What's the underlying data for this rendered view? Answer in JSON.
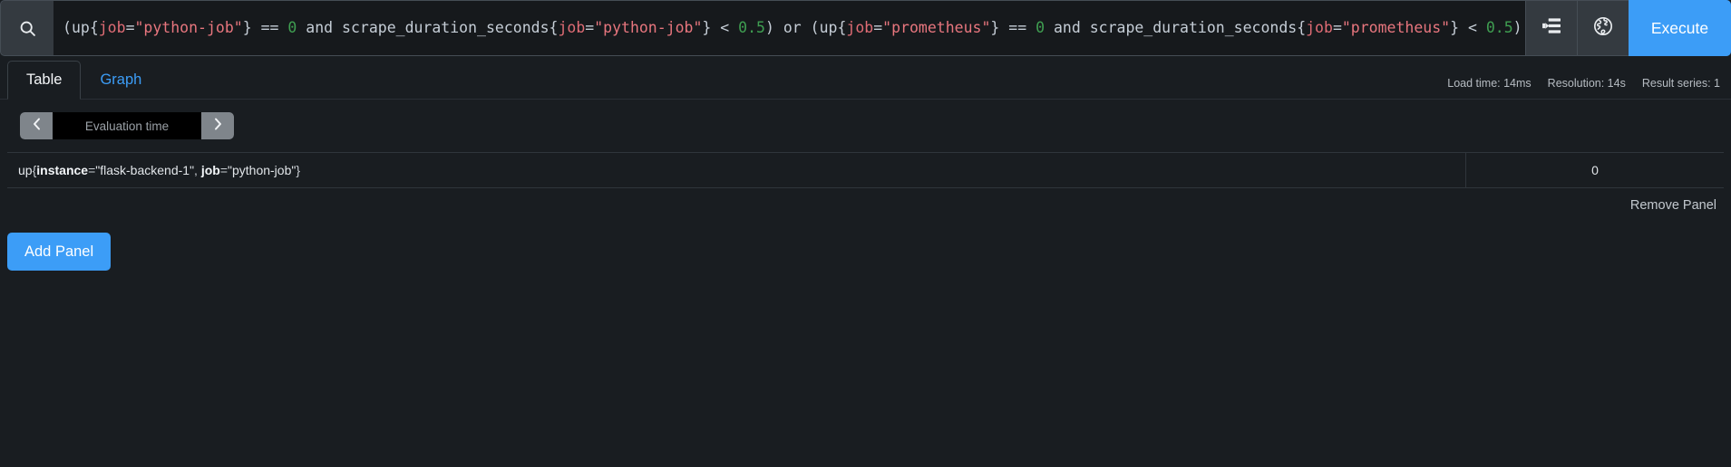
{
  "query_bar": {
    "search_icon": "search-icon",
    "metrics_explorer_icon": "metrics-explorer-icon",
    "globe_icon": "globe-icon",
    "execute_label": "Execute",
    "expression_plain": "(up{job=\"python-job\"} == 0 and scrape_duration_seconds{job=\"python-job\"} < 0.5) or (up{job=\"prometheus\"} == 0 and scrape_duration_seconds{job=\"prometheus\"} < 0.5)",
    "expression_tokens": [
      {
        "t": "(",
        "c": "punct"
      },
      {
        "t": "up",
        "c": "ident"
      },
      {
        "t": "{",
        "c": "punct"
      },
      {
        "t": "job",
        "c": "label"
      },
      {
        "t": "=",
        "c": "op"
      },
      {
        "t": "\"python-job\"",
        "c": "string"
      },
      {
        "t": "}",
        "c": "punct"
      },
      {
        "t": " ",
        "c": "punct"
      },
      {
        "t": "==",
        "c": "op"
      },
      {
        "t": " ",
        "c": "punct"
      },
      {
        "t": "0",
        "c": "number"
      },
      {
        "t": " ",
        "c": "punct"
      },
      {
        "t": "and",
        "c": "kw"
      },
      {
        "t": " ",
        "c": "punct"
      },
      {
        "t": "scrape_duration_seconds",
        "c": "ident"
      },
      {
        "t": "{",
        "c": "punct"
      },
      {
        "t": "job",
        "c": "label"
      },
      {
        "t": "=",
        "c": "op"
      },
      {
        "t": "\"python-job\"",
        "c": "string"
      },
      {
        "t": "}",
        "c": "punct"
      },
      {
        "t": " ",
        "c": "punct"
      },
      {
        "t": "<",
        "c": "op"
      },
      {
        "t": " ",
        "c": "punct"
      },
      {
        "t": "0.5",
        "c": "number"
      },
      {
        "t": ")",
        "c": "punct"
      },
      {
        "t": " ",
        "c": "punct"
      },
      {
        "t": "or",
        "c": "kw"
      },
      {
        "t": " ",
        "c": "punct"
      },
      {
        "t": "(",
        "c": "punct"
      },
      {
        "t": "up",
        "c": "ident"
      },
      {
        "t": "{",
        "c": "punct"
      },
      {
        "t": "job",
        "c": "label"
      },
      {
        "t": "=",
        "c": "op"
      },
      {
        "t": "\"prometheus\"",
        "c": "string"
      },
      {
        "t": "}",
        "c": "punct"
      },
      {
        "t": " ",
        "c": "punct"
      },
      {
        "t": "==",
        "c": "op"
      },
      {
        "t": " ",
        "c": "punct"
      },
      {
        "t": "0",
        "c": "number"
      },
      {
        "t": " ",
        "c": "punct"
      },
      {
        "t": "and",
        "c": "kw"
      },
      {
        "t": " ",
        "c": "punct"
      },
      {
        "t": "scrape_duration_seconds",
        "c": "ident"
      },
      {
        "t": "{",
        "c": "punct"
      },
      {
        "t": "job",
        "c": "label"
      },
      {
        "t": "=",
        "c": "op"
      },
      {
        "t": "\"prometheus\"",
        "c": "string"
      },
      {
        "t": "}",
        "c": "punct"
      },
      {
        "t": " ",
        "c": "punct"
      },
      {
        "t": "<",
        "c": "op"
      },
      {
        "t": " ",
        "c": "punct"
      },
      {
        "t": "0.5",
        "c": "number"
      },
      {
        "t": ")",
        "c": "punct"
      }
    ]
  },
  "tabs": [
    {
      "label": "Table",
      "active": true
    },
    {
      "label": "Graph",
      "active": false
    }
  ],
  "meta": {
    "load_time": "Load time: 14ms",
    "resolution": "Resolution: 14s",
    "result_series": "Result series: 1"
  },
  "eval_time": {
    "prev_icon": "chevron-left-icon",
    "next_icon": "chevron-right-icon",
    "placeholder": "Evaluation time",
    "value": ""
  },
  "result": {
    "rows": [
      {
        "metric_name": "up",
        "labels": [
          {
            "name": "instance",
            "value": "\"flask-backend-1\""
          },
          {
            "name": "job",
            "value": "\"python-job\""
          }
        ],
        "value": "0"
      }
    ]
  },
  "footer": {
    "remove_panel_label": "Remove Panel",
    "add_panel_label": "Add Panel"
  },
  "colors": {
    "accent": "#3c9df7",
    "background": "#191d21",
    "input_background": "#16191c",
    "border": "#454d55",
    "label_token": "#e06c75",
    "string_token": "#e8767e",
    "number_token": "#3f9e51"
  }
}
